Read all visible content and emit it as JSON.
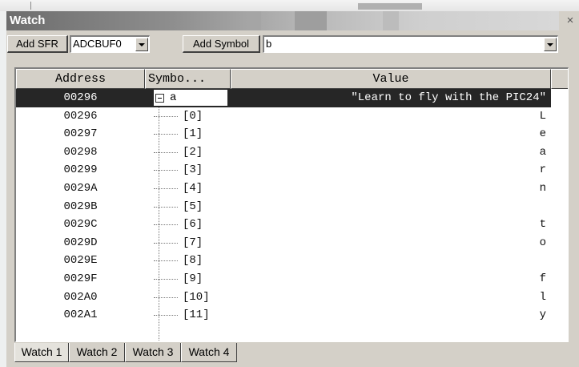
{
  "window": {
    "title": "Watch",
    "close_glyph": "×"
  },
  "toolbar": {
    "add_sfr_label": "Add SFR",
    "sfr_selected": "ADCBUF0",
    "add_symbol_label": "Add Symbol",
    "symbol_value": "b"
  },
  "grid": {
    "columns": {
      "address": "Address",
      "symbol": "Symbo...",
      "value": "Value"
    },
    "parent": {
      "address": "00296",
      "symbol": "a",
      "value": "\"Learn to fly with the PIC24\""
    },
    "rows": [
      {
        "address": "00296",
        "symbol": "[0]",
        "value": "L"
      },
      {
        "address": "00297",
        "symbol": "[1]",
        "value": "e"
      },
      {
        "address": "00298",
        "symbol": "[2]",
        "value": "a"
      },
      {
        "address": "00299",
        "symbol": "[3]",
        "value": "r"
      },
      {
        "address": "0029A",
        "symbol": "[4]",
        "value": "n"
      },
      {
        "address": "0029B",
        "symbol": "[5]",
        "value": ""
      },
      {
        "address": "0029C",
        "symbol": "[6]",
        "value": "t"
      },
      {
        "address": "0029D",
        "symbol": "[7]",
        "value": "o"
      },
      {
        "address": "0029E",
        "symbol": "[8]",
        "value": ""
      },
      {
        "address": "0029F",
        "symbol": "[9]",
        "value": "f"
      },
      {
        "address": "002A0",
        "symbol": "[10]",
        "value": "l"
      },
      {
        "address": "002A1",
        "symbol": "[11]",
        "value": "y"
      }
    ]
  },
  "tabs": [
    {
      "label": "Watch 1"
    },
    {
      "label": "Watch 2"
    },
    {
      "label": "Watch 3"
    },
    {
      "label": "Watch 4"
    }
  ],
  "icons": {
    "collapse": "minus-box-icon",
    "dropdown": "chevron-down-icon",
    "scroll_up": "arrow-up-icon",
    "scroll_down": "arrow-down-icon",
    "close": "close-icon"
  },
  "colors": {
    "selected_row": "#262626",
    "window_face": "#d4d0c8",
    "titlebar_dark": "#6d6d6d"
  }
}
